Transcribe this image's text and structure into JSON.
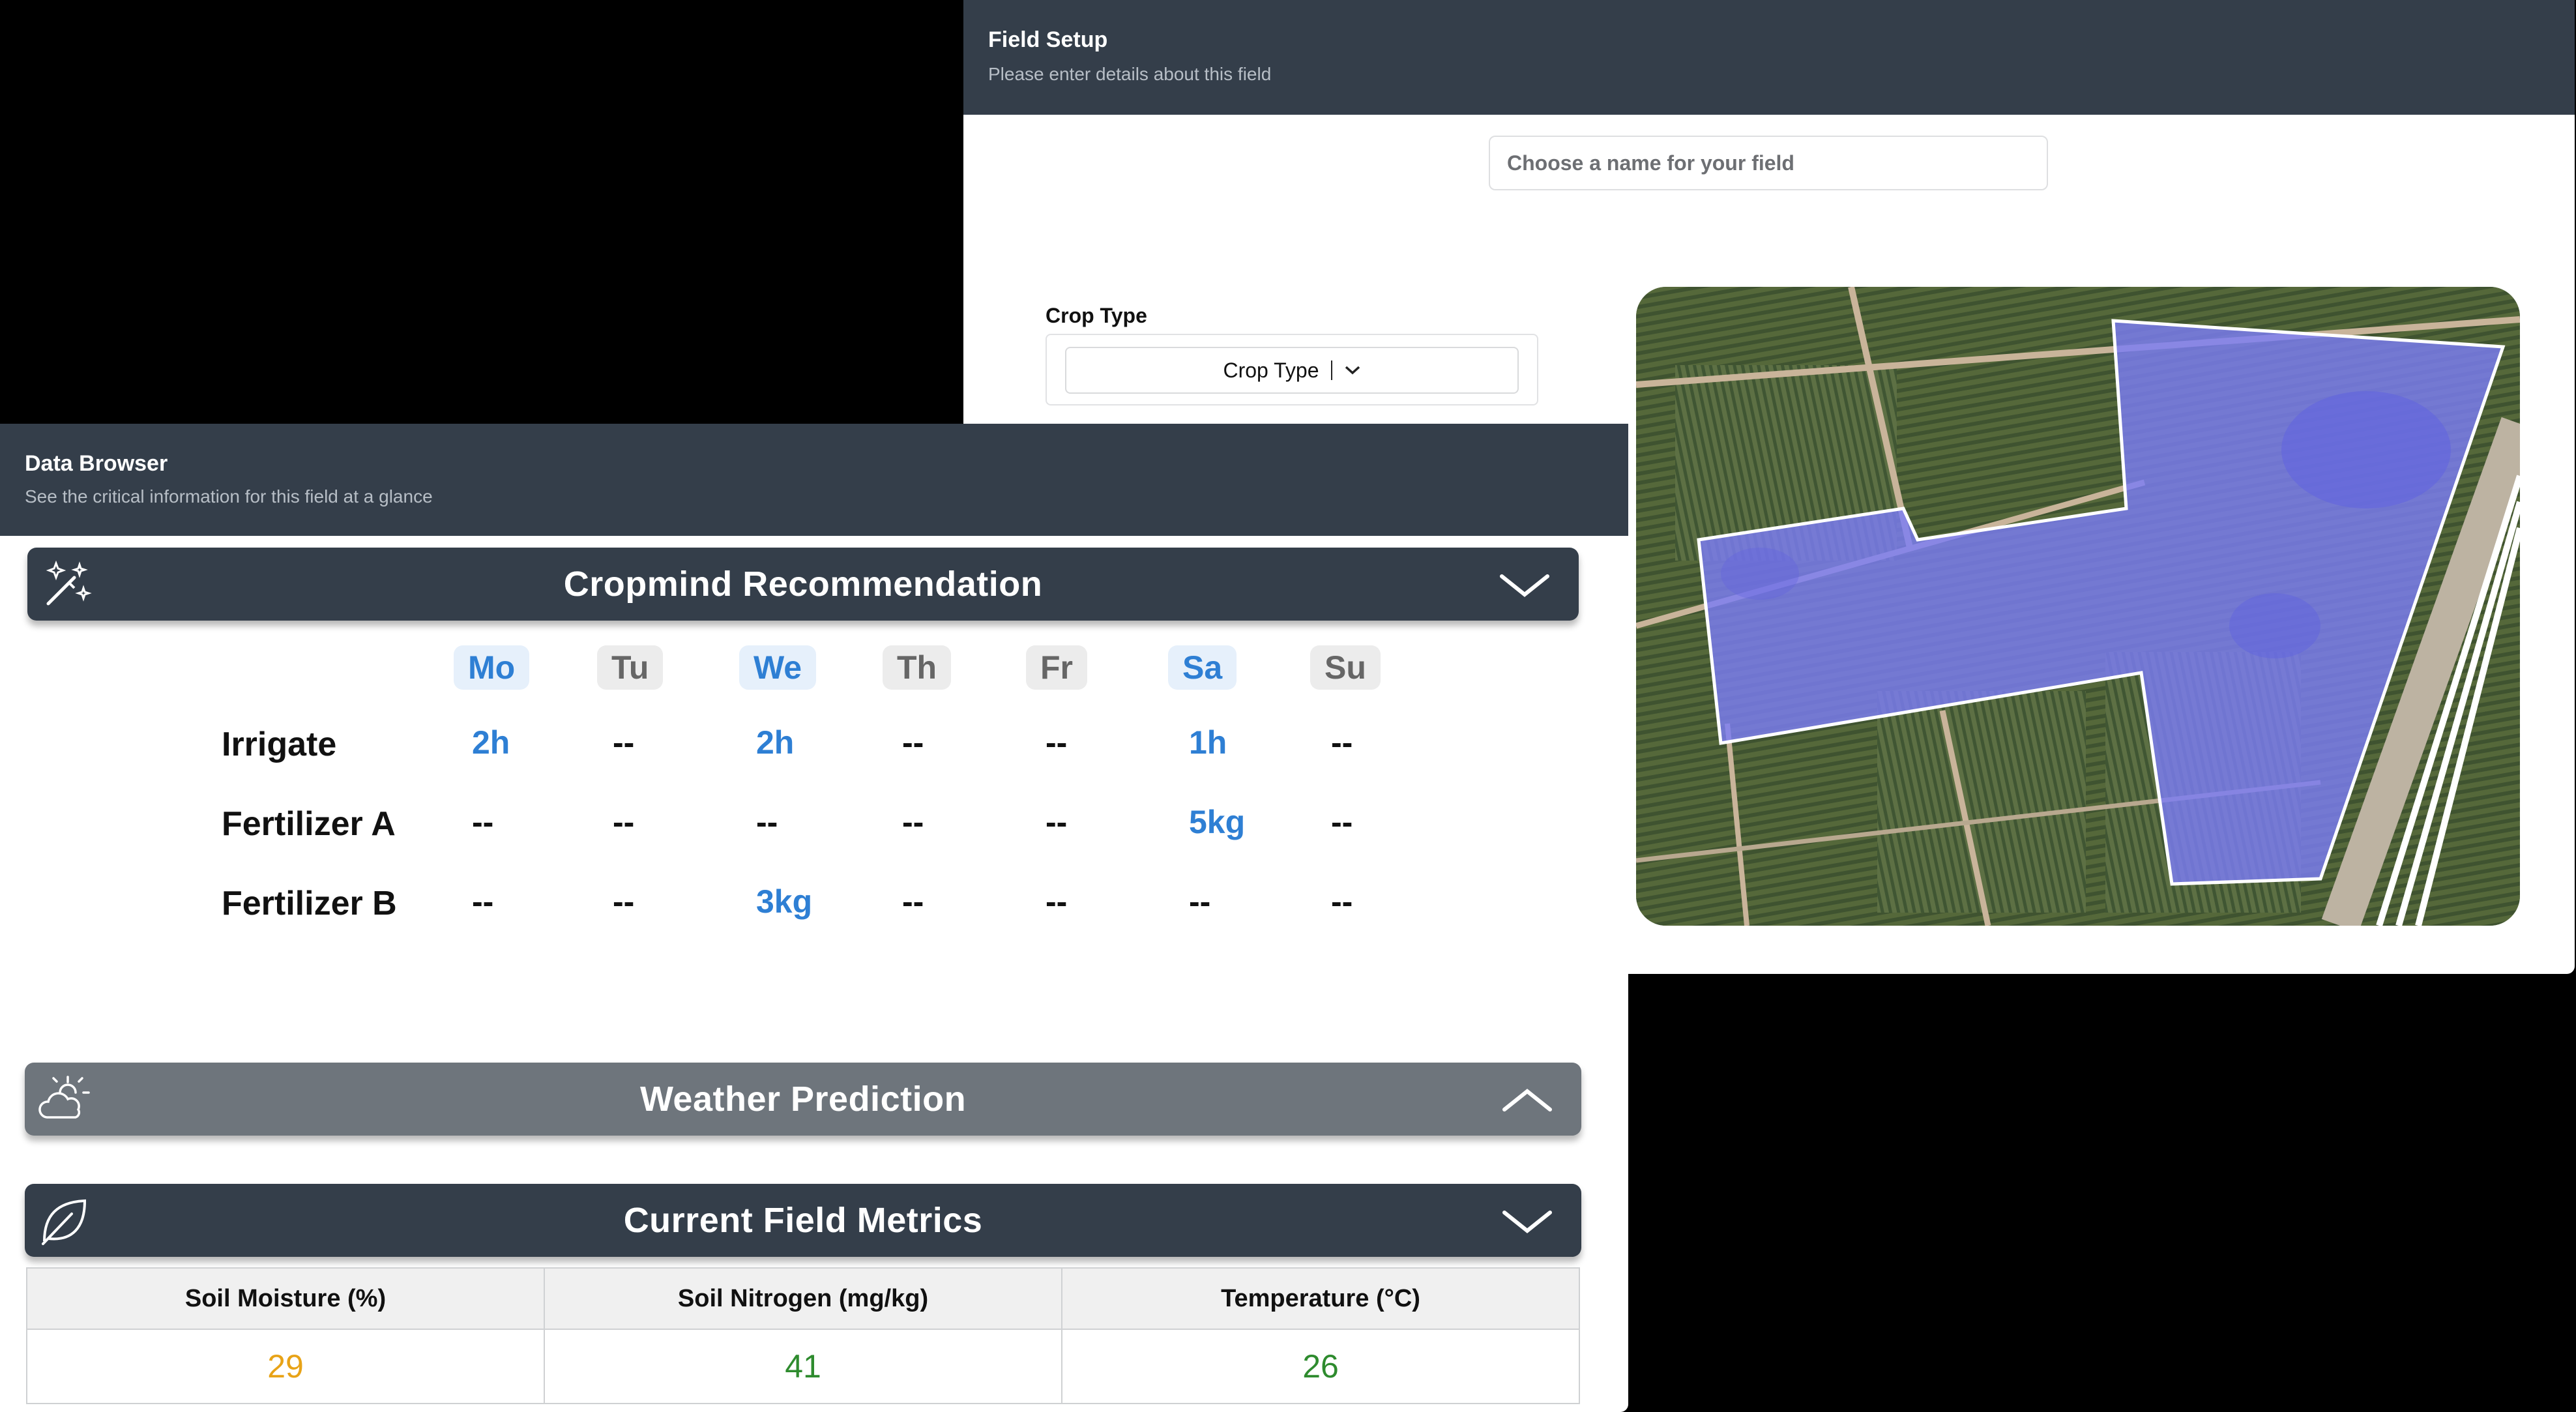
{
  "field_setup": {
    "title": "Field Setup",
    "subtitle": "Please enter details about this field",
    "name_placeholder": "Choose a name for your field",
    "crop_type_label": "Crop Type",
    "crop_type_value": "Crop Type"
  },
  "data_browser": {
    "title": "Data Browser",
    "subtitle": "See the critical information for this field at a glance",
    "recommendation": {
      "title": "Cropmind Recommendation",
      "days": [
        {
          "label": "Mo",
          "active": true
        },
        {
          "label": "Tu",
          "active": false
        },
        {
          "label": "We",
          "active": true
        },
        {
          "label": "Th",
          "active": false
        },
        {
          "label": "Fr",
          "active": false
        },
        {
          "label": "Sa",
          "active": true
        },
        {
          "label": "Su",
          "active": false
        }
      ],
      "rows": [
        {
          "label": "Irrigate",
          "cells": [
            "2h",
            "--",
            "2h",
            "--",
            "--",
            "1h",
            "--"
          ]
        },
        {
          "label": "Fertilizer A",
          "cells": [
            "--",
            "--",
            "--",
            "--",
            "--",
            "5kg",
            "--"
          ]
        },
        {
          "label": "Fertilizer B",
          "cells": [
            "--",
            "--",
            "3kg",
            "--",
            "--",
            "--",
            "--"
          ]
        }
      ]
    },
    "weather": {
      "title": "Weather Prediction"
    },
    "metrics": {
      "title": "Current Field Metrics",
      "headers": [
        "Soil Moisture (%)",
        "Soil Nitrogen (mg/kg)",
        "Temperature  (°C)"
      ],
      "values": [
        "29",
        "41",
        "26"
      ],
      "value_colors": [
        "#e8a317",
        "#2e8b2e",
        "#2e8b2e"
      ]
    }
  },
  "icons": {
    "recommendation": "magic-wand-icon",
    "weather": "sun-cloud-icon",
    "metrics": "leaf-icon",
    "collapse": "chevron-down-icon",
    "expand": "chevron-up-icon"
  },
  "colors": {
    "header_dark": "#343e4a",
    "weather_bar": "#6e757c",
    "accent_blue": "#2e7fd4",
    "polygon_fill": "#7b7cf4"
  }
}
